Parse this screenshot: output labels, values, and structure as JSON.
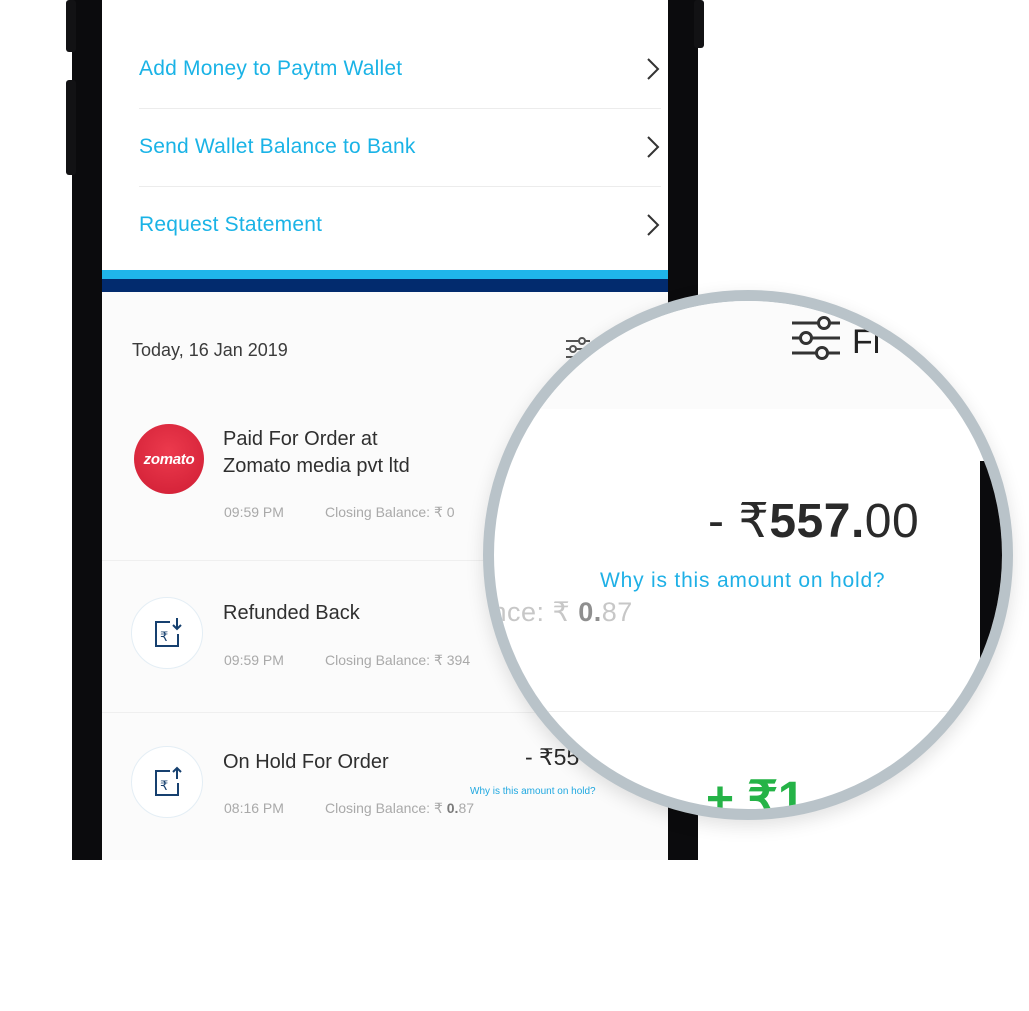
{
  "menu": {
    "items": [
      {
        "label": "Add Money to Paytm Wallet"
      },
      {
        "label": "Send Wallet Balance to Bank"
      },
      {
        "label": "Request Statement"
      }
    ]
  },
  "passbook": {
    "date_header": "Today, 16 Jan 2019",
    "transactions": [
      {
        "logo_text": "zomato",
        "title_line1": "Paid For Order at",
        "title_line2": "Zomato media pvt ltd",
        "time": "09:59 PM",
        "closing_label": "Closing Balance: ₹ 0"
      },
      {
        "title_line1": "Refunded Back",
        "time": "09:59 PM",
        "closing_label": "Closing Balance: ₹ 394"
      },
      {
        "title_line1": "On Hold For Order",
        "time": "08:16 PM",
        "closing_label": "Closing Balance: ₹",
        "closing_value_bold": "0.",
        "closing_value_rest": "87",
        "amount": "- ₹55",
        "hold_link": "Why is this amount on hold?"
      }
    ]
  },
  "magnifier": {
    "filter_label": "Fi",
    "amount_prefix": "- ₹",
    "amount_bold": "557.",
    "amount_decimal": "00",
    "hold_link": "Why is this amount on hold?",
    "closing_partial": "ance: ₹",
    "closing_bold": "0.",
    "closing_rest": "87",
    "green_partial": "+ ₹1"
  },
  "colors": {
    "accent": "#1ab3e6",
    "brand_dark": "#022b6e",
    "zomato_red": "#d7243a",
    "credit_green": "#25b347"
  },
  "icons": [
    "chevron-right-icon",
    "filter-icon",
    "rupee-download-icon",
    "rupee-upload-icon"
  ]
}
